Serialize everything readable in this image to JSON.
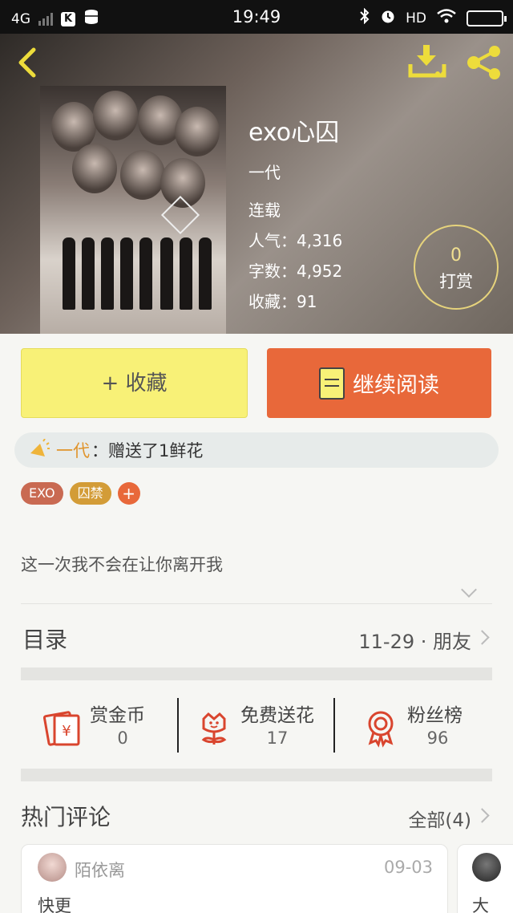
{
  "status_bar": {
    "network": "4G",
    "time": "19:49",
    "hd": "HD"
  },
  "book": {
    "title": "exo心囚",
    "author": "一代",
    "status": "连载",
    "popularity_label": "人气：",
    "popularity": "4,316",
    "word_count_label": "字数：",
    "word_count": "4,952",
    "favorites_label": "收藏：",
    "favorites": "91"
  },
  "tip": {
    "count": "0",
    "label": "打赏"
  },
  "actions": {
    "collect_label": "+ 收藏",
    "read_label": "继续阅读"
  },
  "gift": {
    "user": "一代",
    "message": "：赠送了1鲜花"
  },
  "tags": [
    {
      "label": "EXO",
      "color": "#c96a52"
    },
    {
      "label": "囚禁",
      "color": "#d39c37"
    }
  ],
  "tag_add": "+",
  "intro": "这一次我不会在让你离开我",
  "toc": {
    "label": "目录",
    "latest": "11-29 · 朋友"
  },
  "stats": [
    {
      "name": "赏金币",
      "value": "0"
    },
    {
      "name": "免费送花",
      "value": "17"
    },
    {
      "name": "粉丝榜",
      "value": "96"
    }
  ],
  "hot_comments": {
    "label": "热门评论",
    "all_label": "全部(4)"
  },
  "comments": [
    {
      "user": "陌依离",
      "date": "09-03",
      "text": "快更"
    },
    {
      "text": "大"
    }
  ],
  "colors": {
    "accent_yellow": "#f8f177",
    "accent_orange": "#e8683a",
    "icon_red": "#d9452e",
    "icon_yellow": "#eddc3b"
  }
}
